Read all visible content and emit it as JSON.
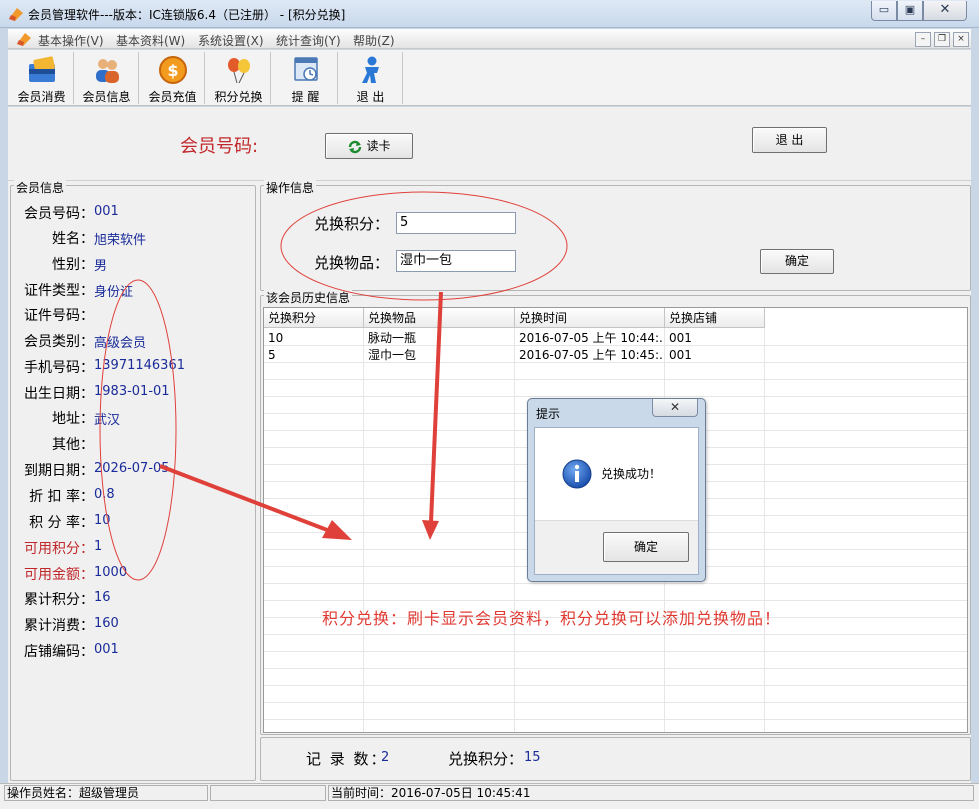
{
  "window": {
    "title": "会员管理软件---版本：IC连锁版6.4（已注册） - [积分兑换]",
    "min_glyph": "▭",
    "max_glyph": "▣",
    "close_glyph": "✕"
  },
  "menu": {
    "items": [
      "基本操作(V)",
      "基本资料(W)",
      "系统设置(X)",
      "统计查询(Y)",
      "帮助(Z)"
    ],
    "mdi_min": "–",
    "mdi_restore": "❐",
    "mdi_close": "×"
  },
  "toolbar": {
    "items": [
      {
        "label": "会员消费",
        "icon": "card-wallet-icon"
      },
      {
        "label": "会员信息",
        "icon": "users-icon"
      },
      {
        "label": "会员充值",
        "icon": "coin-icon"
      },
      {
        "label": "积分兑换",
        "icon": "balloons-icon"
      },
      {
        "label": "提 醒",
        "icon": "reminder-window-icon"
      },
      {
        "label": "退 出",
        "icon": "exit-person-icon"
      }
    ]
  },
  "top": {
    "member_no_label": "会员号码:",
    "read_card": "读卡",
    "exit": "退 出"
  },
  "member_info": {
    "title": "会员信息",
    "fields": [
      {
        "label": "会员号码：",
        "value": "001"
      },
      {
        "label": "姓名：",
        "value": "旭荣软件"
      },
      {
        "label": "性别：",
        "value": "男"
      },
      {
        "label": "证件类型：",
        "value": "身份证"
      },
      {
        "label": "证件号码：",
        "value": ""
      },
      {
        "label": "会员类别：",
        "value": "高级会员"
      },
      {
        "label": "手机号码：",
        "value": "13971146361"
      },
      {
        "label": "出生日期：",
        "value": "1983-01-01"
      },
      {
        "label": "地址：",
        "value": "武汉"
      },
      {
        "label": "其他：",
        "value": ""
      },
      {
        "label": "到期日期：",
        "value": "2026-07-05"
      },
      {
        "label": "折 扣 率：",
        "value": "0.8"
      },
      {
        "label": "积 分 率：",
        "value": "10"
      },
      {
        "label": "可用积分：",
        "value": "1"
      },
      {
        "label": "可用金额：",
        "value": "1000"
      },
      {
        "label": "累计积分：",
        "value": "16"
      },
      {
        "label": "累计消费：",
        "value": "160"
      },
      {
        "label": "店铺编码：",
        "value": "001"
      }
    ]
  },
  "operation": {
    "title": "操作信息",
    "points_label": "兑换积分：",
    "points_value": "5",
    "item_label": "兑换物品：",
    "item_value": "湿巾一包",
    "confirm": "确定"
  },
  "history": {
    "title": "该会员历史信息",
    "columns": [
      "兑换积分",
      "兑换物品",
      "兑换时间",
      "兑换店铺"
    ],
    "rows": [
      [
        "10",
        "脉动一瓶",
        "2016-07-05 上午 10:44:...",
        "001"
      ],
      [
        "5",
        "湿巾一包",
        "2016-07-05 上午 10:45:...",
        "001"
      ]
    ]
  },
  "summary": {
    "records_label": "记 录 数：",
    "records_value": "2",
    "points_label": "兑换积分：",
    "points_value": "15"
  },
  "annotation": "积分兑换：刷卡显示会员资料，积分兑换可以添加兑换物品！",
  "dialog": {
    "title": "提示",
    "close_glyph": "✕",
    "message": "兑换成功！",
    "ok": "确定"
  },
  "status": {
    "operator": "操作员姓名：超级管理员",
    "cell2": "",
    "time": "当前时间：2016-07-05日 10:45:41"
  },
  "colors": {
    "accent_red": "#c0282b",
    "value_blue": "#1a2b9a",
    "annotation_red": "#e03a32"
  }
}
